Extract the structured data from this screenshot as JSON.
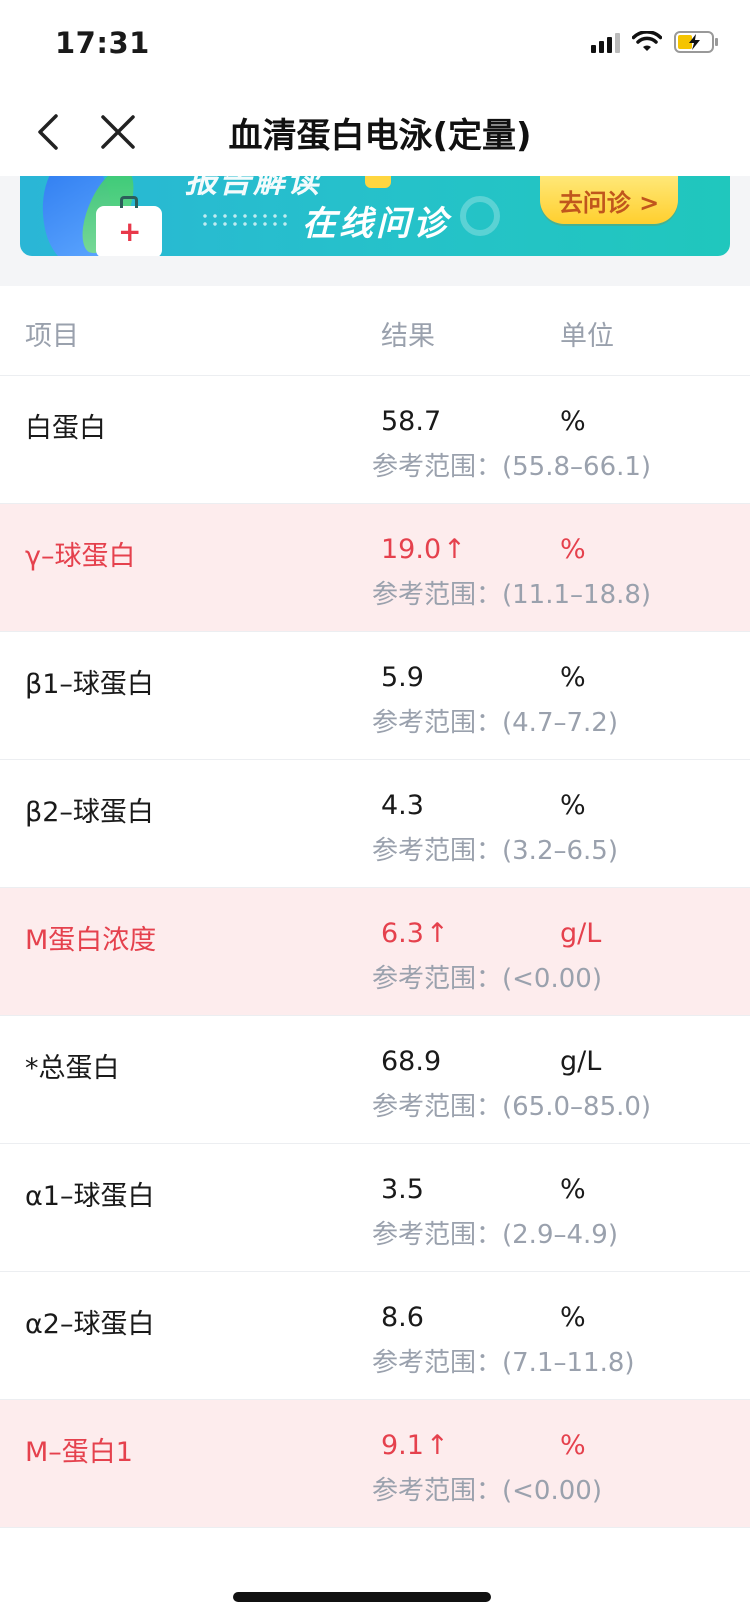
{
  "status_bar": {
    "time": "17:31"
  },
  "nav": {
    "title": "血清蛋白电泳(定量)"
  },
  "banner": {
    "top_text": "报告解读",
    "main_text": "在线问诊",
    "cta_label": "去问诊 >"
  },
  "table": {
    "headers": {
      "item": "项目",
      "result": "结果",
      "unit": "单位"
    },
    "rows": [
      {
        "name": "白蛋白",
        "value": "58.7",
        "flag": "",
        "unit": "%",
        "ref": "参考范围：(55.8–66.1)",
        "abnormal": false
      },
      {
        "name": "γ–球蛋白",
        "value": "19.0",
        "flag": "↑",
        "unit": "%",
        "ref": "参考范围：(11.1–18.8)",
        "abnormal": true
      },
      {
        "name": "β1–球蛋白",
        "value": "5.9",
        "flag": "",
        "unit": "%",
        "ref": "参考范围：(4.7–7.2)",
        "abnormal": false
      },
      {
        "name": "β2–球蛋白",
        "value": "4.3",
        "flag": "",
        "unit": "%",
        "ref": "参考范围：(3.2–6.5)",
        "abnormal": false
      },
      {
        "name": "M蛋白浓度",
        "value": "6.3",
        "flag": "↑",
        "unit": "g/L",
        "ref": "参考范围：(<0.00)",
        "abnormal": true
      },
      {
        "name": "*总蛋白",
        "value": "68.9",
        "flag": "",
        "unit": "g/L",
        "ref": "参考范围：(65.0–85.0)",
        "abnormal": false
      },
      {
        "name": "α1–球蛋白",
        "value": "3.5",
        "flag": "",
        "unit": "%",
        "ref": "参考范围：(2.9–4.9)",
        "abnormal": false
      },
      {
        "name": "α2–球蛋白",
        "value": "8.6",
        "flag": "",
        "unit": "%",
        "ref": "参考范围：(7.1–11.8)",
        "abnormal": false
      },
      {
        "name": "M–蛋白1",
        "value": "9.1",
        "flag": "↑",
        "unit": "%",
        "ref": "参考范围：(<0.00)",
        "abnormal": true
      }
    ]
  },
  "colors": {
    "abnormal_text": "#e5414d",
    "abnormal_bg": "#fdeced",
    "muted": "#9aa1ad",
    "banner": "#25c2c9"
  },
  "icons": {
    "back": "chevron-left-icon",
    "close": "close-icon",
    "signal": "cellular-signal-icon",
    "wifi": "wifi-icon",
    "battery": "battery-charging-icon"
  }
}
